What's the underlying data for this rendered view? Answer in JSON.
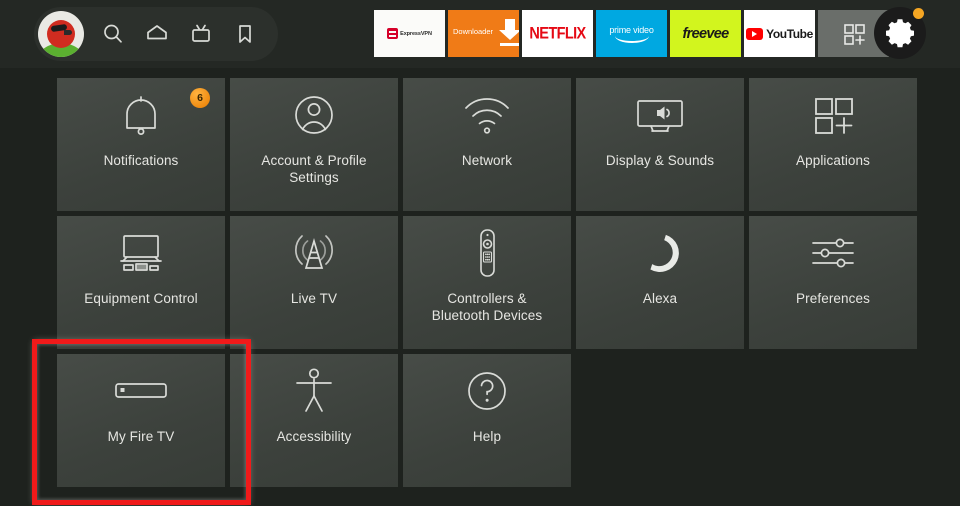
{
  "header": {
    "avatar": {
      "name": "profile-avatar"
    },
    "nav_icons": [
      {
        "name": "search-icon",
        "label": "Search"
      },
      {
        "name": "home-icon",
        "label": "Home"
      },
      {
        "name": "live-tv-icon",
        "label": "Live TV"
      },
      {
        "name": "bookmark-icon",
        "label": "Watchlist"
      }
    ],
    "apps": [
      {
        "name": "expressvpn",
        "label": "ExpressVPN",
        "bg": "#fbfbf9"
      },
      {
        "name": "downloader",
        "label": "Downloader",
        "bg": "#f07b17"
      },
      {
        "name": "netflix",
        "label": "NETFLIX",
        "bg": "#ffffff"
      },
      {
        "name": "prime-video",
        "label": "prime video",
        "bg": "#00a8e1"
      },
      {
        "name": "freevee",
        "label": "freevee",
        "bg": "#d2f51e"
      },
      {
        "name": "youtube",
        "label": "YouTube",
        "bg": "#ffffff"
      },
      {
        "name": "app-library",
        "label": "",
        "bg": "#6a6e6a"
      }
    ],
    "settings_button": {
      "label": "Settings",
      "badge_visible": true,
      "badge_color": "#f5a623"
    }
  },
  "grid": {
    "rows": [
      [
        {
          "label": "Notifications",
          "icon": "bell-icon",
          "badge": "6"
        },
        {
          "label": "Account & Profile Settings",
          "icon": "account-profile-icon",
          "badge": ""
        },
        {
          "label": "Network",
          "icon": "wifi-icon",
          "badge": ""
        },
        {
          "label": "Display & Sounds",
          "icon": "display-sounds-icon",
          "badge": ""
        },
        {
          "label": "Applications",
          "icon": "applications-grid-icon",
          "badge": ""
        }
      ],
      [
        {
          "label": "Equipment Control",
          "icon": "equipment-control-icon",
          "badge": ""
        },
        {
          "label": "Live TV",
          "icon": "antenna-icon",
          "badge": ""
        },
        {
          "label": "Controllers & Bluetooth Devices",
          "icon": "remote-control-icon",
          "badge": ""
        },
        {
          "label": "Alexa",
          "icon": "alexa-ring-icon",
          "badge": ""
        },
        {
          "label": "Preferences",
          "icon": "sliders-icon",
          "badge": ""
        }
      ],
      [
        {
          "label": "My Fire TV",
          "icon": "fire-tv-stick-icon",
          "badge": "",
          "highlighted": true
        },
        {
          "label": "Accessibility",
          "icon": "accessibility-icon",
          "badge": ""
        },
        {
          "label": "Help",
          "icon": "question-mark-icon",
          "badge": ""
        }
      ]
    ]
  },
  "colors": {
    "page_background": "#1e221e",
    "header_background": "#242824",
    "tile_background": "#3f443f",
    "tile_label": "#e6e6e2",
    "highlight_border": "#f01a1a",
    "badge_orange": "#f08c12"
  }
}
